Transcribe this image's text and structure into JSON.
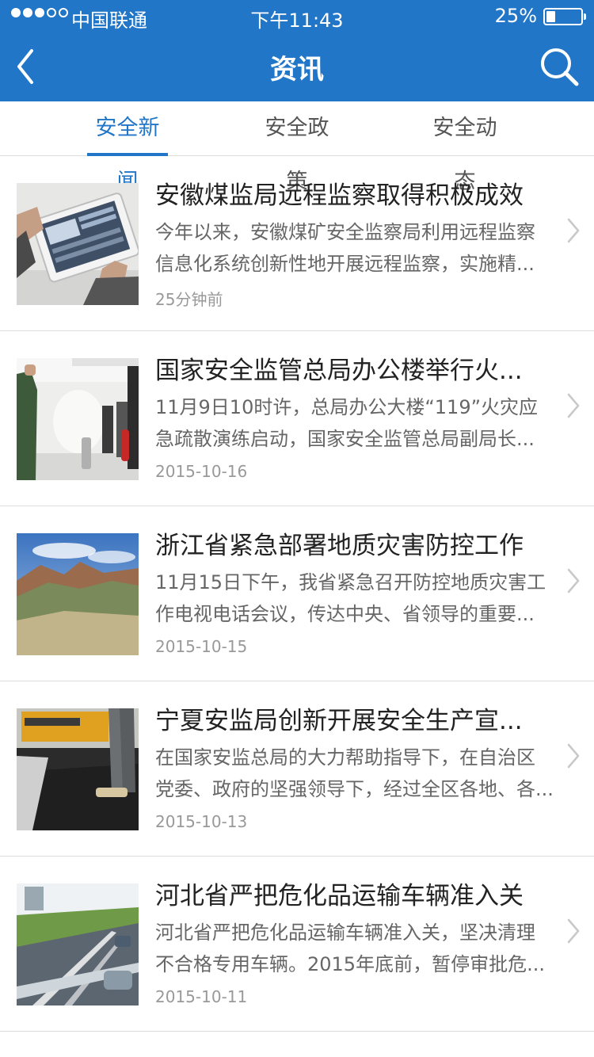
{
  "status_bar": {
    "carrier": "中国联通",
    "time": "下午11:43",
    "battery_percent": "25%",
    "battery_level": 0.25,
    "signal_bars_filled": 3,
    "signal_bars_total": 5
  },
  "nav": {
    "title": "资讯",
    "back_icon": "chevron-left-icon",
    "search_icon": "search-icon"
  },
  "tabs": [
    {
      "label": "安全新闻",
      "active": true
    },
    {
      "label": "安全政策",
      "active": false
    },
    {
      "label": "安全动态",
      "active": false
    }
  ],
  "colors": {
    "brand": "#2176c8",
    "divider": "#dddddd",
    "title": "#222222",
    "summary": "#666666",
    "date": "#999999"
  },
  "news": [
    {
      "title": "安徽煤监局远程监察取得积极成效",
      "summary_line1": "今年以来，安徽煤矿安全监察局利用远程监察",
      "summary_line2": "信息化系统创新性地开展远程监察，实施精...",
      "date": "25分钟前",
      "thumb": "tablet-photo"
    },
    {
      "title": "国家安全监管总局办公楼举行火...",
      "summary_line1": "11月9日10时许，总局办公大楼“119”火灾应",
      "summary_line2": "急疏散演练启动，国家安全监管总局副局长...",
      "date": "2015-10-16",
      "thumb": "fire-drill-photo"
    },
    {
      "title": "浙江省紧急部署地质灾害防控工作",
      "summary_line1": "11月15日下午，我省紧急召开防控地质灾害工",
      "summary_line2": "作电视电话会议，传达中央、省领导的重要...",
      "date": "2015-10-15",
      "thumb": "mountain-photo"
    },
    {
      "title": "宁夏安监局创新开展安全生产宣...",
      "summary_line1": "在国家安监总局的大力帮助指导下，在自治区",
      "summary_line2": "党委、政府的坚强领导下，经过全区各地、各...",
      "date": "2015-10-13",
      "thumb": "road-paving-photo"
    },
    {
      "title": "河北省严把危化品运输车辆准入关",
      "summary_line1": "河北省严把危化品运输车辆准入关，坚决清理",
      "summary_line2": "不合格专用车辆。2015年底前，暂停审批危...",
      "date": "2015-10-11",
      "thumb": "highway-photo"
    }
  ]
}
